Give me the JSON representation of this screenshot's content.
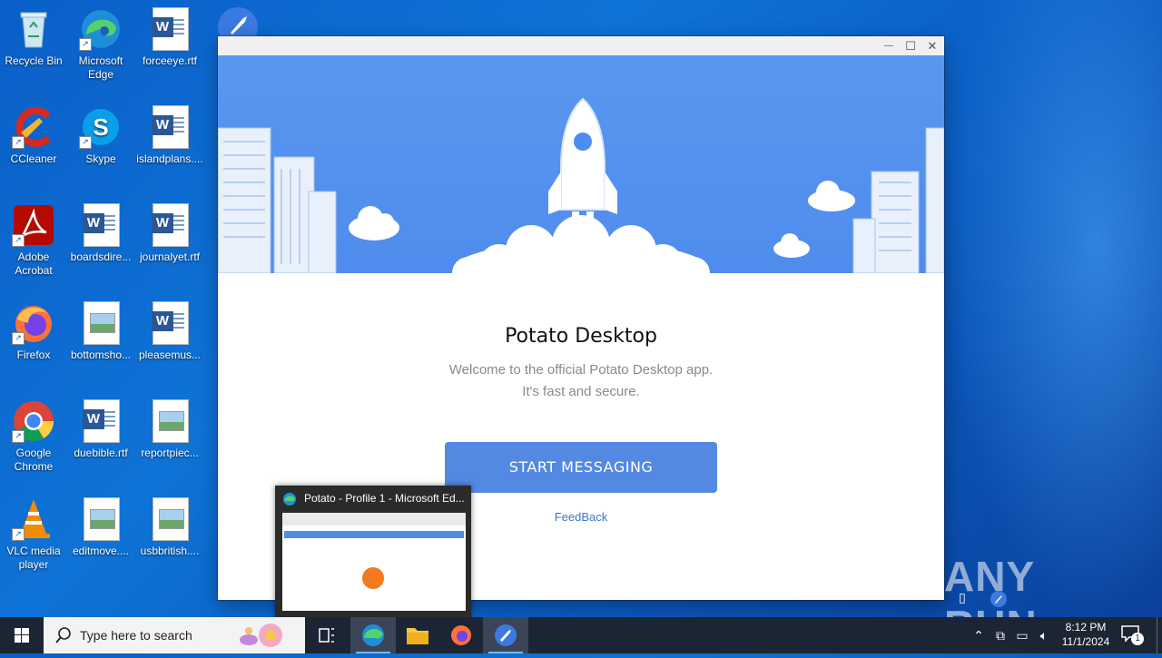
{
  "desktop": {
    "icons": [
      {
        "label": "Recycle Bin"
      },
      {
        "label": "Microsoft Edge"
      },
      {
        "label": "forceeye.rtf"
      },
      {
        "label": "CCleaner"
      },
      {
        "label": "Skype"
      },
      {
        "label": "islandplans...."
      },
      {
        "label": "Adobe Acrobat"
      },
      {
        "label": "boardsdire..."
      },
      {
        "label": "journalyet.rtf"
      },
      {
        "label": "Firefox"
      },
      {
        "label": "bottomsho..."
      },
      {
        "label": "pleasemus..."
      },
      {
        "label": "Google Chrome"
      },
      {
        "label": "duebible.rtf"
      },
      {
        "label": "reportpiec..."
      },
      {
        "label": "VLC media player"
      },
      {
        "label": "editmove...."
      },
      {
        "label": "usbbritish...."
      }
    ]
  },
  "window": {
    "title_buttons": {
      "minimize": "—",
      "maximize": "☐",
      "close": "✕"
    },
    "welcome_title": "Potato Desktop",
    "welcome_line1": "Welcome to the official Potato Desktop app.",
    "welcome_line2": "It's fast and secure.",
    "start_button": "START MESSAGING",
    "feedback_link": "FeedBack"
  },
  "preview": {
    "title": "Potato - Profile 1 - Microsoft Ed..."
  },
  "watermark": "ANY RUN",
  "taskbar": {
    "search_placeholder": "Type here to search",
    "time": "8:12 PM",
    "date": "11/1/2024",
    "notification_count": "1"
  },
  "colors": {
    "accent": "#5389e3",
    "hero": "#4f8ced",
    "desktop": "#0e73d6"
  }
}
